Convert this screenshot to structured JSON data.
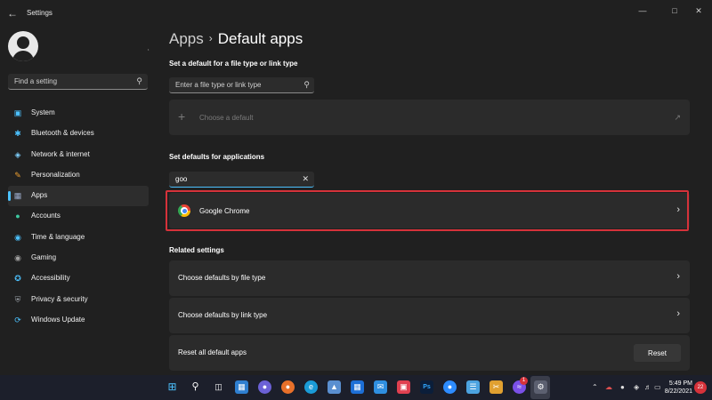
{
  "window": {
    "back_icon": "back-arrow-icon",
    "title": "Settings",
    "controls": [
      "minimize-icon",
      "maximize-icon",
      "close-icon"
    ]
  },
  "sidebar": {
    "search_placeholder": "Find a setting",
    "items": [
      {
        "label": "System",
        "icon": "system-icon",
        "color": "#4cc2ff",
        "active": false
      },
      {
        "label": "Bluetooth & devices",
        "icon": "bluetooth-icon",
        "color": "#4cc2ff",
        "active": false
      },
      {
        "label": "Network & internet",
        "icon": "wifi-icon",
        "color": "#7fd0ff",
        "active": false
      },
      {
        "label": "Personalization",
        "icon": "brush-icon",
        "color": "#f0a030",
        "active": false
      },
      {
        "label": "Apps",
        "icon": "apps-icon",
        "color": "#9aa9c9",
        "active": true
      },
      {
        "label": "Accounts",
        "icon": "accounts-icon",
        "color": "#3dc9a0",
        "active": false
      },
      {
        "label": "Time & language",
        "icon": "globe-icon",
        "color": "#4cc2ff",
        "active": false
      },
      {
        "label": "Gaming",
        "icon": "gaming-icon",
        "color": "#a0a0a0",
        "active": false
      },
      {
        "label": "Accessibility",
        "icon": "accessibility-icon",
        "color": "#4cc2ff",
        "active": false
      },
      {
        "label": "Privacy & security",
        "icon": "shield-icon",
        "color": "#9aa0a8",
        "active": false
      },
      {
        "label": "Windows Update",
        "icon": "update-icon",
        "color": "#4cc2ff",
        "active": false
      }
    ]
  },
  "main": {
    "breadcrumb": {
      "parent": "Apps",
      "separator": "›",
      "current": "Default apps"
    },
    "file_type_section": {
      "label": "Set a default for a file type or link type",
      "input_placeholder": "Enter a file type or link type",
      "choose_default": "Choose a default"
    },
    "apps_section": {
      "label": "Set defaults for applications",
      "search_value": "goo",
      "results": [
        {
          "name": "Google Chrome",
          "icon": "chrome-icon"
        }
      ]
    },
    "related": {
      "label": "Related settings",
      "rows": [
        {
          "label": "Choose defaults by file type"
        },
        {
          "label": "Choose defaults by link type"
        }
      ],
      "reset_row": {
        "label": "Reset all default apps",
        "button": "Reset"
      }
    }
  },
  "taskbar": {
    "pinned": [
      "start-icon",
      "search-icon",
      "task-view-icon",
      "widgets-icon",
      "teams-chat-icon",
      "firefox-icon",
      "edge-icon",
      "store-icon",
      "microsoft-store-icon",
      "mail-icon",
      "photos-icon",
      "photoshop-icon",
      "zoom-icon",
      "notepad-icon",
      "snipping-icon",
      "messenger-icon",
      "settings-icon"
    ],
    "messenger_badge": "1",
    "photoshop_label": "Ps",
    "tray_icons": [
      "chevron-up-icon",
      "onedrive-icon",
      "mic-icon",
      "wifi-icon",
      "volume-icon",
      "battery-icon"
    ],
    "time": "5:49 PM",
    "date": "8/22/2021",
    "notifications": "22"
  },
  "colors": {
    "accent": "#4cc2ff",
    "highlight": "#d6323a",
    "background": "#202020",
    "card": "#2b2b2b"
  }
}
